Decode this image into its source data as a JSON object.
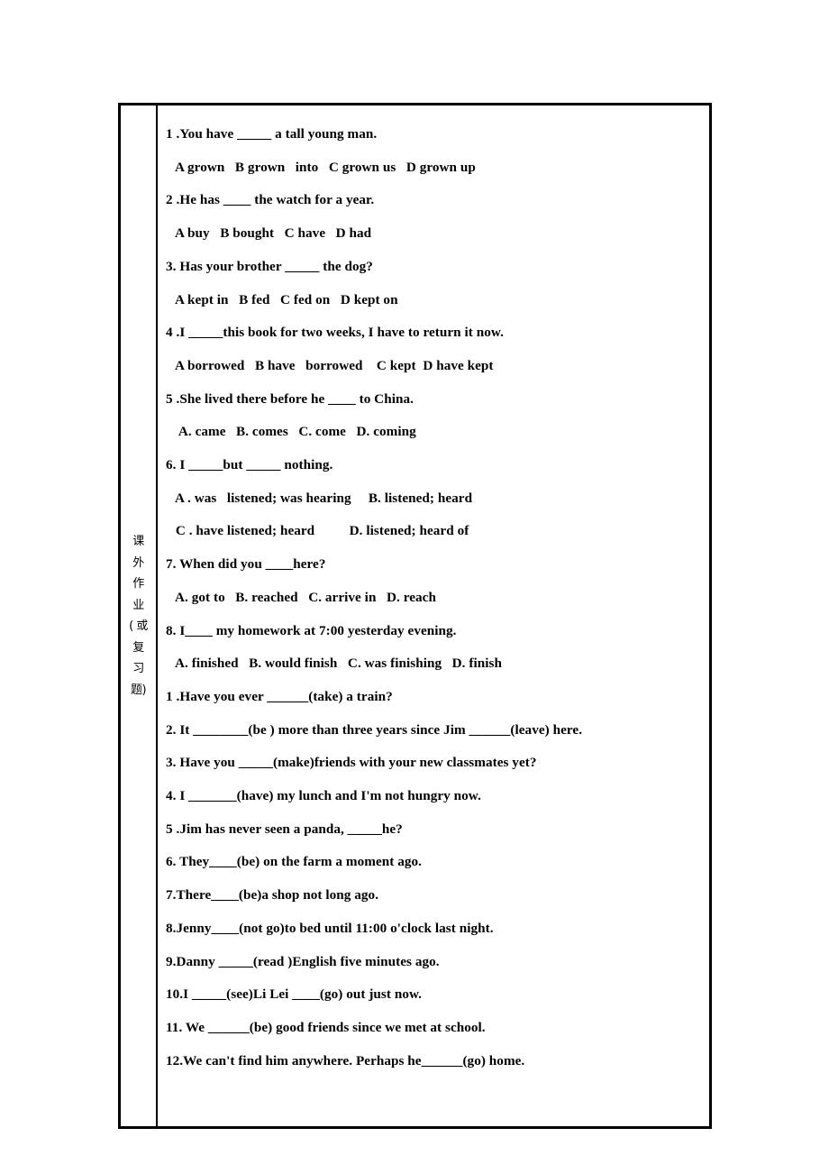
{
  "document": {
    "type": "worksheet",
    "sidebar_label_vertical": [
      "课",
      "外",
      "作",
      "业",
      "( 或",
      "复",
      "习",
      "题)"
    ],
    "sidebar_label_text": "课外作业（或复习题）",
    "border_color": "#000000",
    "background_color": "#ffffff"
  },
  "sections": [
    {
      "name": "multiple-choice",
      "items": [
        {
          "prompt_num": "1 .",
          "prompt": "You have ",
          "prompt_blank": 5,
          "prompt_tail": " a tall young man.",
          "options_lines": [
            " A grown   B grown   into   C grown us   D grown up"
          ]
        },
        {
          "prompt_num": "2 .",
          "prompt": "He has ",
          "prompt_blank": 4,
          "prompt_tail": " the watch for a year.",
          "options_lines": [
            " A buy   B bought   C have   D had"
          ]
        },
        {
          "prompt_num": "3. ",
          "prompt": "Has your brother ",
          "prompt_blank": 5,
          "prompt_tail": " the dog?",
          "options_lines": [
            " A kept in   B fed   C fed on   D kept on"
          ]
        },
        {
          "prompt_num": "4 .",
          "prompt": "I ",
          "prompt_blank": 5,
          "prompt_tail": "this book for two weeks, I have to return it now.",
          "options_lines": [
            " A borrowed   B have   borrowed    C kept  D have kept"
          ]
        },
        {
          "prompt_num": "5 .",
          "prompt": "She lived there before he ",
          "prompt_blank": 4,
          "prompt_tail": " to China.",
          "options_lines": [
            "  A. came   B. comes   C. come   D. coming"
          ]
        },
        {
          "prompt_num": "6. ",
          "prompt": "I ",
          "prompt_blank": 5,
          "prompt_tail": "but _____ nothing.",
          "options_lines": [
            " A . was   listened; was hearing     B. listened; heard",
            " C . have listened; heard          D. listened; heard of"
          ]
        },
        {
          "prompt_num": "7. ",
          "prompt": "When did you ",
          "prompt_blank": 4,
          "prompt_tail": "here?",
          "options_lines": [
            " A. got to   B. reached   C. arrive in   D. reach"
          ]
        },
        {
          "prompt_num": "8. ",
          "prompt": "I",
          "prompt_blank": 4,
          "prompt_tail": " my homework at 7:00 yesterday evening.",
          "options_lines": [
            " A. finished   B. would finish   C. was finishing   D. finish"
          ]
        }
      ]
    },
    {
      "name": "fill-in-the-blank",
      "items": [
        {
          "text": "1 .Have you ever ______(take) a train?"
        },
        {
          "text": "2. It ________(be ) more than three years since Jim ______(leave) here."
        },
        {
          "text": "3. Have you _____(make)friends with your new classmates yet?"
        },
        {
          "text": "4. I _______(have) my lunch and I'm not hungry now."
        },
        {
          "text": "5 .Jim has never seen a panda, _____he?"
        },
        {
          "text": "6. They____(be) on the farm a moment ago."
        },
        {
          "text": "7.There____(be)a shop not long ago."
        },
        {
          "text": "8.Jenny____(not go)to bed until 11:00 o'clock last night."
        },
        {
          "text": "9.Danny _____(read )English five minutes ago."
        },
        {
          "text": "10.I _____(see)Li Lei ____(go) out just now."
        },
        {
          "text": "11. We ______(be) good friends since we met at school."
        },
        {
          "text": "12.We can't find him anywhere. Perhaps he______(go) home."
        }
      ]
    }
  ],
  "lines_flat": [
    "1 .You have _____ a tall young man.",
    " A grown   B grown   into   C grown us   D grown up",
    "2 .He has ____ the watch for a year.",
    " A buy   B bought   C have   D had",
    "3. Has your brother _____ the dog?",
    " A kept in   B fed   C fed on   D kept on",
    "4 .I _____this book for two weeks, I have to return it now.",
    " A borrowed   B have   borrowed    C kept  D have kept",
    "5 .She lived there before he ____ to China.",
    "  A. came   B. comes   C. come   D. coming",
    "6. I _____but _____ nothing.",
    " A . was   listened; was hearing     B. listened; heard",
    " C . have listened; heard          D. listened; heard of",
    "7. When did you ____here?",
    " A. got to   B. reached   C. arrive in   D. reach",
    "8. I____ my homework at 7:00 yesterday evening.",
    " A. finished   B. would finish   C. was finishing   D. finish",
    "1 .Have you ever ______(take) a train?",
    "2. It ________(be ) more than three years since Jim ______(leave) here.",
    "3. Have you _____(make)friends with your new classmates yet?",
    "4. I _______(have) my lunch and I'm not hungry now.",
    "5 .Jim has never seen a panda, _____he?",
    "6. They____(be) on the farm a moment ago.",
    "7.There____(be)a shop not long ago.",
    "8.Jenny____(not go)to bed until 11:00 o'clock last night.",
    "9.Danny _____(read )English five minutes ago.",
    "10.I _____(see)Li Lei ____(go) out just now.",
    "11. We ______(be) good friends since we met at school.",
    "12.We can't find him anywhere. Perhaps he______(go) home."
  ]
}
